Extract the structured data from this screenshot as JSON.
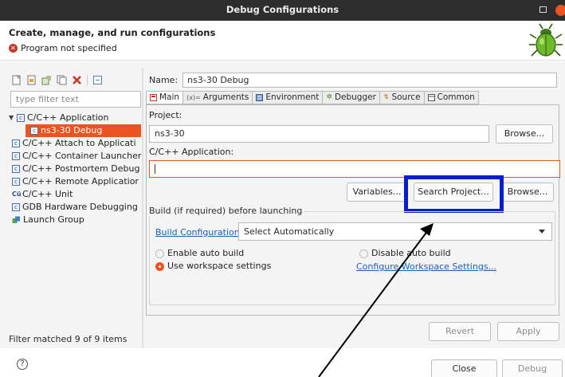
{
  "window": {
    "title": "Debug Configurations"
  },
  "header": {
    "title": "Create, manage, and run configurations",
    "error": "Program not specified"
  },
  "left": {
    "filter_placeholder": "type filter text",
    "tree": [
      {
        "label": "C/C++ Application",
        "expanded": true,
        "selected": false,
        "indent": 0
      },
      {
        "label": "ns3-30 Debug",
        "selected": true,
        "indent": 1
      },
      {
        "label": "C/C++ Attach to Applicati",
        "indent": 0
      },
      {
        "label": "C/C++ Container Launcher",
        "indent": 0
      },
      {
        "label": "C/C++ Postmortem Debug",
        "indent": 0
      },
      {
        "label": "C/C++ Remote Applicatior",
        "indent": 0
      },
      {
        "label": "C/C++ Unit",
        "indent": 0
      },
      {
        "label": "GDB Hardware Debugging",
        "indent": 0
      },
      {
        "label": "Launch Group",
        "indent": 0
      }
    ],
    "status": "Filter matched 9 of 9 items"
  },
  "right": {
    "name_label": "Name:",
    "name_value": "ns3-30 Debug",
    "tabs": [
      "Main",
      "Arguments",
      "Environment",
      "Debugger",
      "Source",
      "Common"
    ],
    "project_label": "Project:",
    "project_value": "ns3-30",
    "browse_label": "Browse...",
    "app_label": "C/C++ Application:",
    "app_value": "",
    "variables_label": "Variables...",
    "search_label": "Search Project...",
    "browse2_label": "Browse...",
    "build_group_title": "Build (if required) before launching",
    "build_config_link": "Build Configuration:",
    "build_config_value": "Select Automatically",
    "enable_auto": "Enable auto build",
    "disable_auto": "Disable auto build",
    "use_workspace": "Use workspace settings",
    "configure_link": "Configure Workspace Settings...",
    "revert_label": "Revert",
    "apply_label": "Apply"
  },
  "footer": {
    "close_label": "Close",
    "debug_label": "Debug"
  },
  "colors": {
    "accent": "#e95420",
    "highlight_box": "#0a1bd0",
    "link": "#1a5fb4"
  }
}
